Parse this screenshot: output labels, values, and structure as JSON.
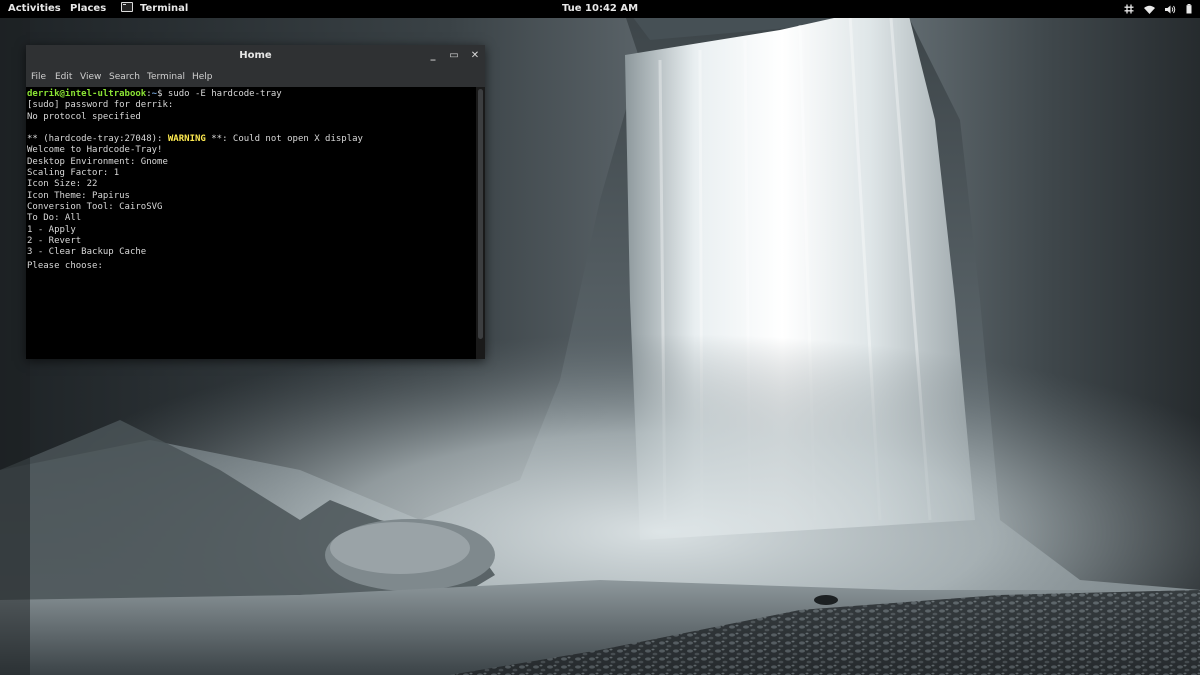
{
  "topbar": {
    "activities": "Activities",
    "places": "Places",
    "app_name": "Terminal",
    "clock": "Tue 10:42 AM",
    "tray_icons": [
      "network-icon",
      "wifi-icon",
      "volume-icon",
      "battery-icon"
    ]
  },
  "window": {
    "title": "Home",
    "controls": {
      "minimize": "_",
      "maximize": "▭",
      "close": "✕"
    },
    "menu": [
      "File",
      "Edit",
      "View",
      "Search",
      "Terminal",
      "Help"
    ]
  },
  "terminal": {
    "prompt_user": "derrik@intel-ultrabook",
    "prompt_sep": ":",
    "prompt_path": "~",
    "prompt_sym": "$ ",
    "command": "sudo -E hardcode-tray",
    "lines": [
      "[sudo] password for derrik:",
      "No protocol specified",
      ""
    ],
    "warning_prefix": "** (hardcode-tray:27048): ",
    "warning_word": "WARNING",
    "warning_suffix": " **: Could not open X display",
    "output": [
      "Welcome to Hardcode-Tray!",
      "Desktop Environment: Gnome",
      "Scaling Factor: 1",
      "Icon Size: 22",
      "Icon Theme: Papirus",
      "Conversion Tool: CairoSVG",
      "To Do: All",
      "1 - Apply",
      "2 - Revert",
      "3 - Clear Backup Cache",
      "Please choose: "
    ]
  },
  "colors": {
    "topbar_bg": "#000000",
    "titlebar_bg": "#2f3133",
    "terminal_bg": "#000000",
    "prompt_user": "#8ae234",
    "prompt_path": "#729fcf",
    "warning": "#fce94f"
  }
}
